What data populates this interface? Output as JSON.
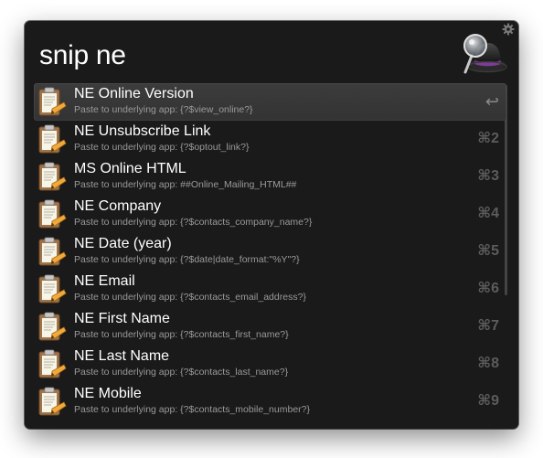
{
  "search": {
    "query": "snip ne"
  },
  "icons": {
    "settings": "gear-icon",
    "app": "alfred-hat-icon",
    "result": "clipboard-snippet-icon",
    "return": "return-key-icon"
  },
  "colors": {
    "window_bg": "#1a1a1a",
    "selected_row_bg": "#3a3a3a",
    "title_text": "#ffffff",
    "subtitle_text": "#9a9a9a",
    "shortcut_text": "#5c5c5c"
  },
  "results": [
    {
      "title": "NE Online Version",
      "subtitle": "Paste to underlying app: {?$view_online?}",
      "shortcut": "↩",
      "selected": true
    },
    {
      "title": "NE Unsubscribe Link",
      "subtitle": "Paste to underlying app: {?$optout_link?}",
      "shortcut": "⌘2"
    },
    {
      "title": "MS Online HTML",
      "subtitle": "Paste to underlying app: ##Online_Mailing_HTML##",
      "shortcut": "⌘3"
    },
    {
      "title": "NE Company",
      "subtitle": "Paste to underlying app: {?$contacts_company_name?}",
      "shortcut": "⌘4"
    },
    {
      "title": "NE Date (year)",
      "subtitle": "Paste to underlying app: {?$date|date_format:\"%Y\"?}",
      "shortcut": "⌘5"
    },
    {
      "title": "NE Email",
      "subtitle": "Paste to underlying app: {?$contacts_email_address?}",
      "shortcut": "⌘6"
    },
    {
      "title": "NE First Name",
      "subtitle": "Paste to underlying app: {?$contacts_first_name?}",
      "shortcut": "⌘7"
    },
    {
      "title": "NE Last Name",
      "subtitle": "Paste to underlying app: {?$contacts_last_name?}",
      "shortcut": "⌘8"
    },
    {
      "title": "NE Mobile",
      "subtitle": "Paste to underlying app: {?$contacts_mobile_number?}",
      "shortcut": "⌘9"
    }
  ]
}
